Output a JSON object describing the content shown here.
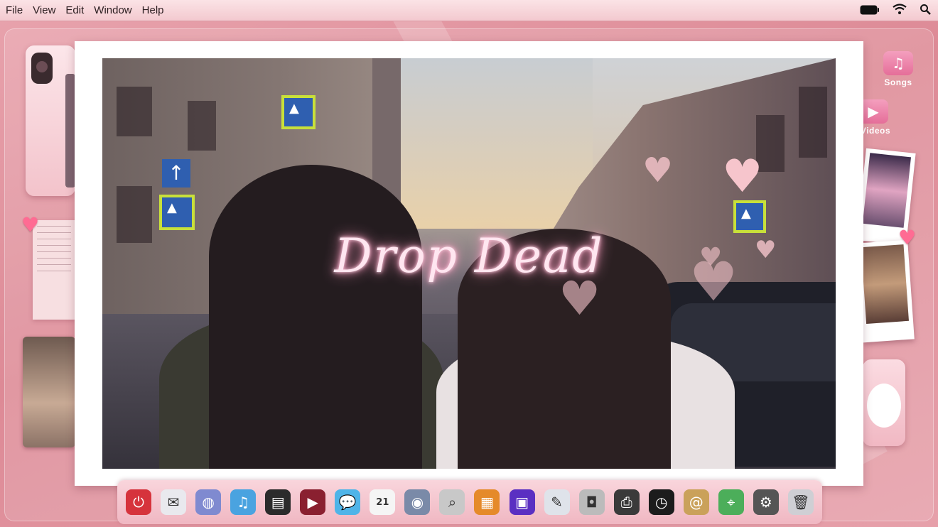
{
  "menubar": {
    "items": [
      "File",
      "View",
      "Edit",
      "Window",
      "Help"
    ],
    "status_icons": [
      "battery-icon",
      "wifi-icon",
      "search-icon"
    ]
  },
  "desktop": {
    "icons": [
      {
        "label": "Songs",
        "icon": "music-note-icon"
      },
      {
        "label": "Videos",
        "icon": "video-icon"
      }
    ]
  },
  "main": {
    "title": "Drop Dead"
  },
  "dock": {
    "items": [
      {
        "name": "power-icon",
        "glyph": "⏻",
        "color": "#d6333c"
      },
      {
        "name": "mail-icon",
        "glyph": "✉",
        "color": "#e9e9ee"
      },
      {
        "name": "browser-globe-icon",
        "glyph": "◍",
        "color": "#7f8ad0"
      },
      {
        "name": "music-icon",
        "glyph": "♫",
        "color": "#4aa3e0"
      },
      {
        "name": "clapperboard-icon",
        "glyph": "▤",
        "color": "#2b2b2b"
      },
      {
        "name": "video-player-icon",
        "glyph": "▶",
        "color": "#8a2030"
      },
      {
        "name": "messages-icon",
        "glyph": "💬",
        "color": "#4fb4e8"
      },
      {
        "name": "calendar-icon",
        "glyph": "21",
        "color": "#f5f5f5"
      },
      {
        "name": "quicktime-icon",
        "glyph": "◉",
        "color": "#7a8aa8"
      },
      {
        "name": "search-magnifier-icon",
        "glyph": "⌕",
        "color": "#c8c8c8"
      },
      {
        "name": "photos-icon",
        "glyph": "▦",
        "color": "#e58a2a"
      },
      {
        "name": "media-app-icon",
        "glyph": "▣",
        "color": "#5a2fc2"
      },
      {
        "name": "notes-icon",
        "glyph": "✎",
        "color": "#dfe3ea"
      },
      {
        "name": "camera-icon",
        "glyph": "◘",
        "color": "#bbbbbb"
      },
      {
        "name": "printer-icon",
        "glyph": "⎙",
        "color": "#3a3a3a"
      },
      {
        "name": "clock-icon",
        "glyph": "◷",
        "color": "#1c1c1c"
      },
      {
        "name": "contacts-icon",
        "glyph": "@",
        "color": "#caa15a"
      },
      {
        "name": "maps-icon",
        "glyph": "⌖",
        "color": "#4cae5a"
      },
      {
        "name": "settings-gear-icon",
        "glyph": "⚙",
        "color": "#555555"
      },
      {
        "name": "trash-icon",
        "glyph": "🗑",
        "color": "#cfcfd4"
      }
    ]
  },
  "colors": {
    "background": "#dd8a96",
    "accent": "#ff9ec2"
  }
}
